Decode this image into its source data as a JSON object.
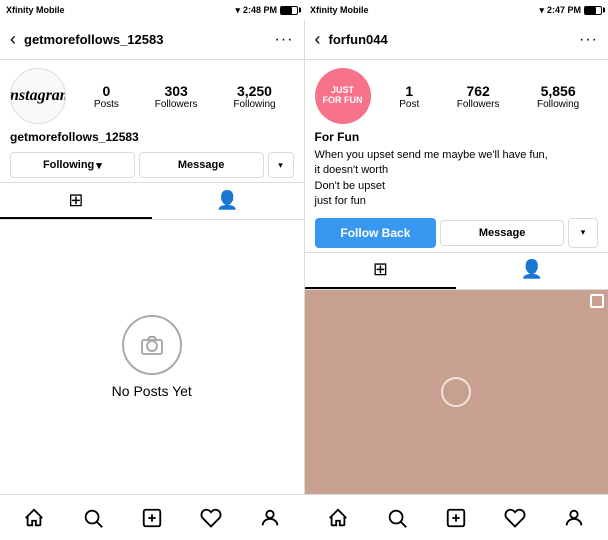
{
  "left_panel": {
    "status": {
      "carrier": "Xfinity Mobile",
      "time": "2:48 PM",
      "battery": 67
    },
    "header": {
      "back_label": "‹",
      "username": "getmorefollows_12583",
      "more_label": "···"
    },
    "logo": "Instagram",
    "stats": {
      "posts_num": "0",
      "posts_label": "Posts",
      "followers_num": "303",
      "followers_label": "Followers",
      "following_num": "3,250",
      "following_label": "Following"
    },
    "profile_name": "getmorefollows_12583",
    "buttons": {
      "following_label": "Following",
      "chevron": "▾",
      "message_label": "Message"
    },
    "tabs": {
      "grid_active": true,
      "profile_active": false
    },
    "no_posts_text": "No Posts Yet"
  },
  "right_panel": {
    "status": {
      "carrier": "Xfinity Mobile",
      "time": "2:47 PM",
      "battery": 70
    },
    "header": {
      "back_label": "‹",
      "username": "forfun044",
      "more_label": "···"
    },
    "avatar_text": "JUST\nFOR FUN",
    "stats": {
      "posts_num": "1",
      "posts_label": "Post",
      "followers_num": "762",
      "followers_label": "Followers",
      "following_num": "5,856",
      "following_label": "Following"
    },
    "profile_name": "For Fun",
    "bio_lines": [
      "When you upset send me maybe we'll have fun,",
      "it doesn't worth",
      "Don't be upset",
      "just for fun"
    ],
    "buttons": {
      "follow_back_label": "Follow Back",
      "message_label": "Message",
      "chevron": "▾"
    },
    "tabs": {
      "grid_active": true,
      "profile_active": false
    }
  },
  "bottom_nav": {
    "icons": [
      "home",
      "search",
      "add",
      "heart",
      "profile"
    ]
  }
}
